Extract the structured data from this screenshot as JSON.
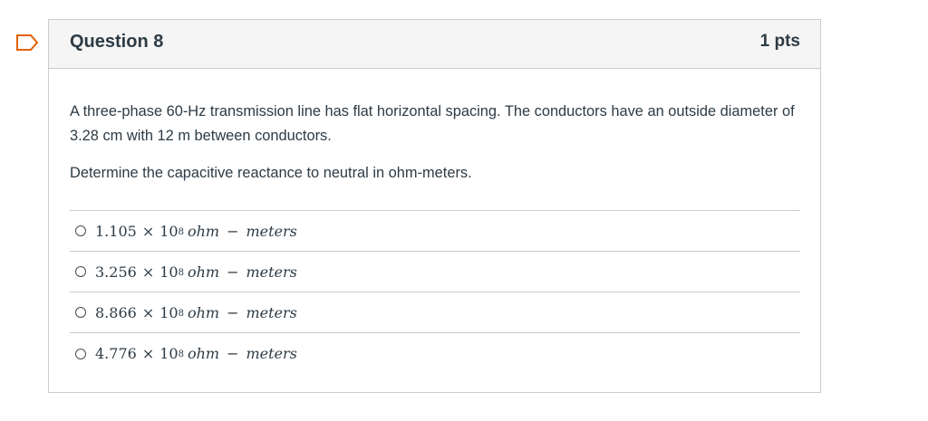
{
  "question": {
    "title": "Question 8",
    "points": "1 pts",
    "paragraph1": "A three-phase 60-Hz transmission line has flat horizontal spacing. The conductors have an outside diameter of 3.28 cm with 12 m between conductors.",
    "paragraph2": "Determine the capacitive reactance to neutral in ohm-meters."
  },
  "answers": [
    {
      "mantissa": "1.105",
      "times": "×",
      "base": "10",
      "exponent": "8",
      "unit_a": "ohm",
      "op": "−",
      "unit_b": "meters"
    },
    {
      "mantissa": "3.256",
      "times": "×",
      "base": "10",
      "exponent": "8",
      "unit_a": "ohm",
      "op": "−",
      "unit_b": "meters"
    },
    {
      "mantissa": "8.866",
      "times": "×",
      "base": "10",
      "exponent": "8",
      "unit_a": "ohm",
      "op": "−",
      "unit_b": "meters"
    },
    {
      "mantissa": "4.776",
      "times": "×",
      "base": "10",
      "exponent": "8",
      "unit_a": "ohm",
      "op": "−",
      "unit_b": "meters"
    }
  ],
  "icons": {
    "bookmark": "bookmark-flag-icon",
    "radio": "radio-button-icon"
  },
  "colors": {
    "text": "#2d3b45",
    "border": "#c7cdd1",
    "header_bg": "#f5f5f5",
    "bookmark": "#e66000"
  }
}
